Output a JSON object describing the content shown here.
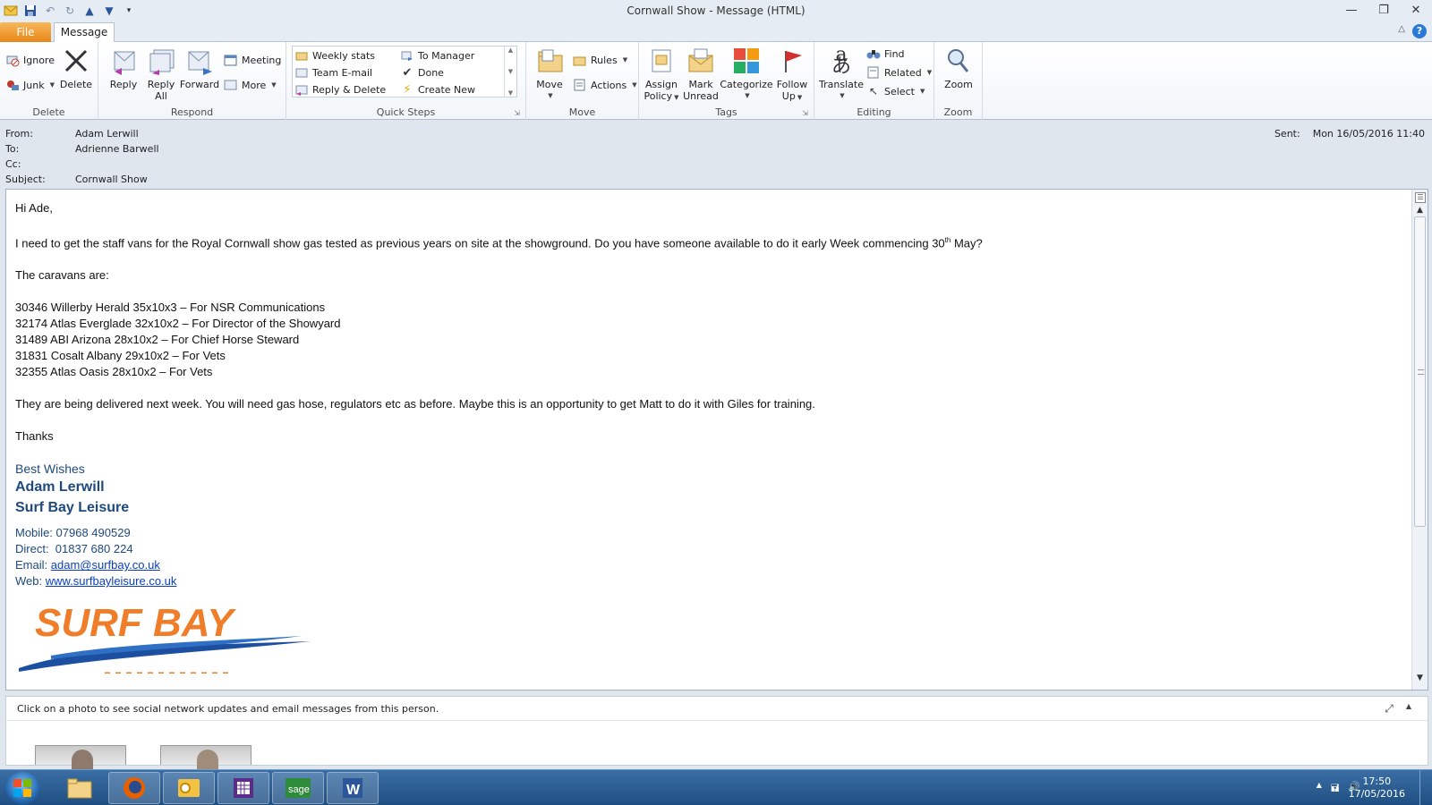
{
  "window": {
    "title": "Cornwall Show  -  Message (HTML)"
  },
  "tabs": {
    "file": "File",
    "message": "Message"
  },
  "ribbon": {
    "delete_group": {
      "label": "Delete",
      "ignore": "Ignore",
      "junk": "Junk",
      "delete": "Delete"
    },
    "respond_group": {
      "label": "Respond",
      "reply": "Reply",
      "reply_all_1": "Reply",
      "reply_all_2": "All",
      "forward": "Forward",
      "meeting": "Meeting",
      "more": "More"
    },
    "quicksteps_group": {
      "label": "Quick Steps",
      "items": [
        "Weekly stats",
        "To Manager",
        "Team E-mail",
        "Done",
        "Reply & Delete",
        "Create New"
      ]
    },
    "move_group": {
      "label": "Move",
      "move": "Move",
      "rules": "Rules",
      "actions": "Actions"
    },
    "tags_group": {
      "label": "Tags",
      "assign_1": "Assign",
      "assign_2": "Policy",
      "mark_1": "Mark",
      "mark_2": "Unread",
      "categorize": "Categorize",
      "follow_1": "Follow",
      "follow_2": "Up"
    },
    "editing_group": {
      "label": "Editing",
      "translate": "Translate",
      "find": "Find",
      "related": "Related",
      "select": "Select"
    },
    "zoom_group": {
      "label": "Zoom",
      "zoom": "Zoom"
    }
  },
  "header": {
    "from_label": "From:",
    "from": "Adam Lerwill",
    "to_label": "To:",
    "to": "Adrienne Barwell",
    "cc_label": "Cc:",
    "cc": "",
    "subject_label": "Subject:",
    "subject": "Cornwall Show",
    "sent_label": "Sent:",
    "sent": "Mon 16/05/2016 11:40"
  },
  "body": {
    "greeting": "Hi Ade,",
    "para1_a": "I need to get the staff vans for the Royal Cornwall show gas tested as previous years on site at the showground.  Do you have someone available to do it early Week commencing 30",
    "para1_sup": "th",
    "para1_b": " May?",
    "caravans_intro": "The caravans are:",
    "caravans": [
      "30346 Willerby Herald 35x10x3 – For NSR Communications",
      "32174 Atlas Everglade 32x10x2 – For Director of the Showyard",
      "31489 ABI Arizona 28x10x2 – For Chief Horse Steward",
      "31831 Cosalt Albany 29x10x2 – For Vets",
      "32355 Atlas Oasis 28x10x2 – For Vets"
    ],
    "para2": "They are being delivered next week.  You will need gas hose, regulators etc as before.  Maybe this is an opportunity to get Matt to do it with Giles for training.",
    "thanks": "Thanks"
  },
  "signature": {
    "wishes": "Best Wishes",
    "name": "Adam Lerwill",
    "company": "Surf Bay Leisure",
    "mobile_label": "Mobile:",
    "mobile": "07968 490529",
    "direct_label": "Direct:",
    "direct": "01837 680 224",
    "email_label": "Email:",
    "email": "adam@surfbay.co.uk",
    "web_label": "Web:",
    "web": "www.surfbayleisure.co.uk",
    "logo_text": "SURF BAY"
  },
  "people_pane": {
    "text": "Click on a photo to see social network updates and email messages from this person."
  },
  "taskbar": {
    "time": "17:50",
    "date": "17/05/2016"
  },
  "colors": {
    "file_tab": "#f2a23b",
    "signature_blue": "#1f497d",
    "link": "#0b3ec2",
    "logo_orange": "#f07d2a",
    "logo_blue": "#1c4fa0"
  }
}
